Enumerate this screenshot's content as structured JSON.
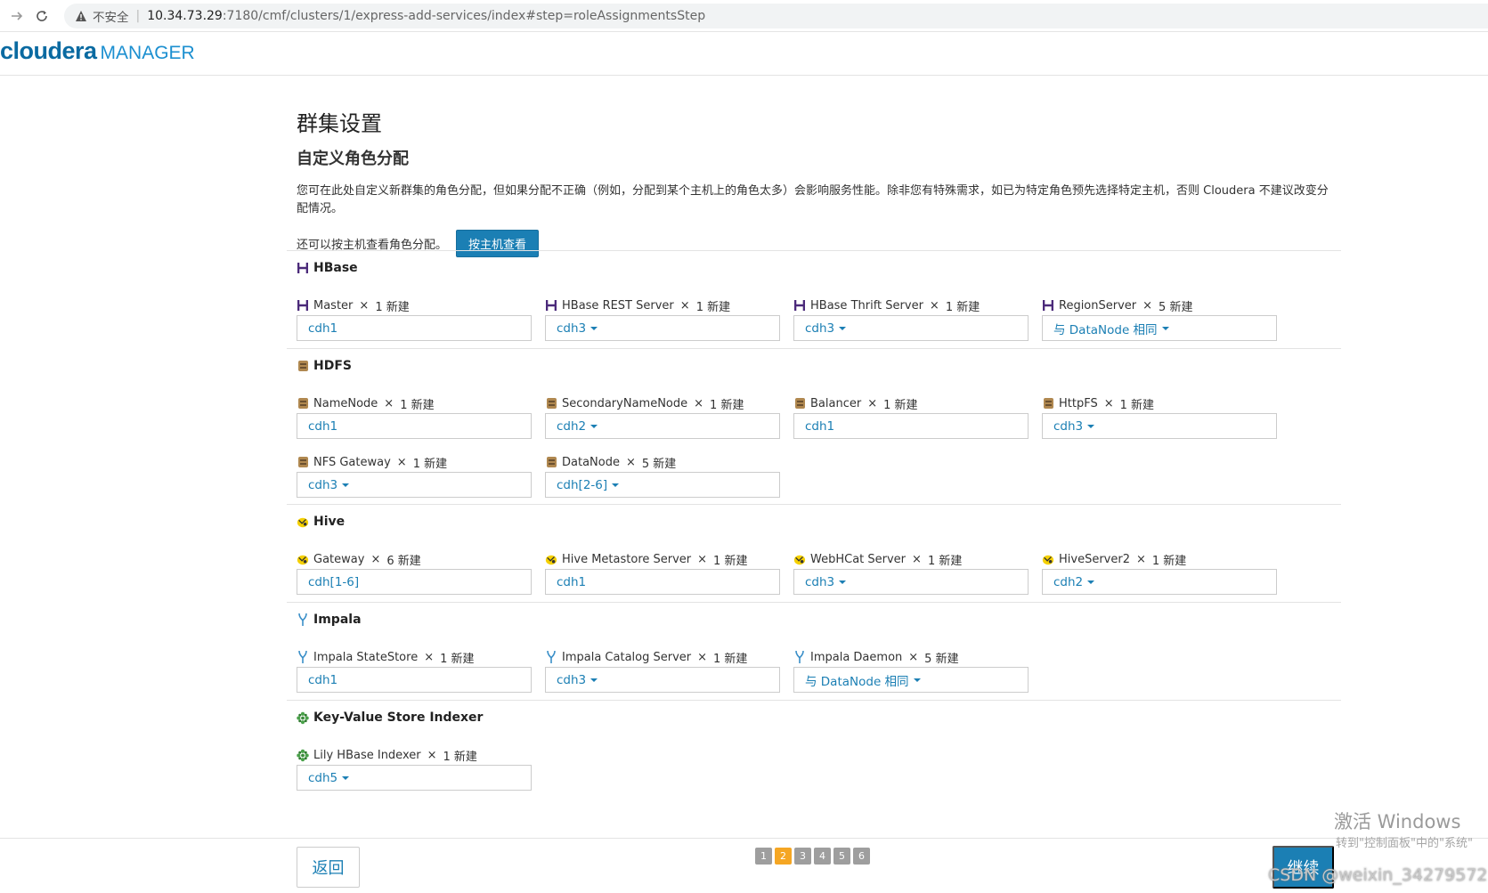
{
  "browser": {
    "security_label": "不安全",
    "url_host": "10.34.73.29",
    "url_path": ":7180/cmf/clusters/1/express-add-services/index#step=roleAssignmentsStep"
  },
  "header": {
    "logo_text": "cloudera",
    "logo_sub": "MANAGER"
  },
  "page": {
    "title": "群集设置",
    "subtitle": "自定义角色分配",
    "intro": "您可在此处自定义新群集的角色分配，但如果分配不正确（例如，分配到某个主机上的角色太多）会影响服务性能。除非您有特殊需求，如已为特定角色预先选择特定主机，否则 Cloudera 不建议改变分配情况。",
    "by_host_text": "还可以按主机查看角色分配。",
    "by_host_button": "按主机查看"
  },
  "services": [
    {
      "name": "HBase",
      "icon": "hbase-icon",
      "roles": [
        {
          "name": "Master",
          "count": "1 新建",
          "value": "cdh1",
          "dropdown": false
        },
        {
          "name": "HBase REST Server",
          "count": "1 新建",
          "value": "cdh3",
          "dropdown": true
        },
        {
          "name": "HBase Thrift Server",
          "count": "1 新建",
          "value": "cdh3",
          "dropdown": true
        },
        {
          "name": "RegionServer",
          "count": "5 新建",
          "value": "与 DataNode 相同",
          "dropdown": true
        }
      ]
    },
    {
      "name": "HDFS",
      "icon": "hdfs-icon",
      "roles": [
        {
          "name": "NameNode",
          "count": "1 新建",
          "value": "cdh1",
          "dropdown": false
        },
        {
          "name": "SecondaryNameNode",
          "count": "1 新建",
          "value": "cdh2",
          "dropdown": true
        },
        {
          "name": "Balancer",
          "count": "1 新建",
          "value": "cdh1",
          "dropdown": false
        },
        {
          "name": "HttpFS",
          "count": "1 新建",
          "value": "cdh3",
          "dropdown": true
        },
        {
          "name": "NFS Gateway",
          "count": "1 新建",
          "value": "cdh3",
          "dropdown": true
        },
        {
          "name": "DataNode",
          "count": "5 新建",
          "value": "cdh[2-6]",
          "dropdown": true
        }
      ]
    },
    {
      "name": "Hive",
      "icon": "hive-icon",
      "roles": [
        {
          "name": "Gateway",
          "count": "6 新建",
          "value": "cdh[1-6]",
          "dropdown": false
        },
        {
          "name": "Hive Metastore Server",
          "count": "1 新建",
          "value": "cdh1",
          "dropdown": false
        },
        {
          "name": "WebHCat Server",
          "count": "1 新建",
          "value": "cdh3",
          "dropdown": true
        },
        {
          "name": "HiveServer2",
          "count": "1 新建",
          "value": "cdh2",
          "dropdown": true
        }
      ]
    },
    {
      "name": "Impala",
      "icon": "impala-icon",
      "roles": [
        {
          "name": "Impala StateStore",
          "count": "1 新建",
          "value": "cdh1",
          "dropdown": false
        },
        {
          "name": "Impala Catalog Server",
          "count": "1 新建",
          "value": "cdh3",
          "dropdown": true
        },
        {
          "name": "Impala Daemon",
          "count": "5 新建",
          "value": "与 DataNode 相同",
          "dropdown": true
        }
      ]
    },
    {
      "name": "Key-Value Store Indexer",
      "icon": "lily-indexer-icon",
      "roles": [
        {
          "name": "Lily HBase Indexer",
          "count": "1 新建",
          "value": "cdh5",
          "dropdown": true
        }
      ]
    }
  ],
  "footer": {
    "back_label": "返回",
    "continue_label": "继续",
    "steps": [
      "1",
      "2",
      "3",
      "4",
      "5",
      "6"
    ],
    "active_step": "2"
  },
  "watermark": {
    "line1": "激活 Windows",
    "line2": "转到\"控制面板\"中的\"系统\"",
    "csdn": "CSDN @weixin_34279572"
  },
  "colors": {
    "accent": "#1b7fb4",
    "step_active": "#f5a623",
    "step_inactive": "#9e9e9e",
    "logo_orange": "#f26f21",
    "logo_blue": "#1b8fd0"
  }
}
